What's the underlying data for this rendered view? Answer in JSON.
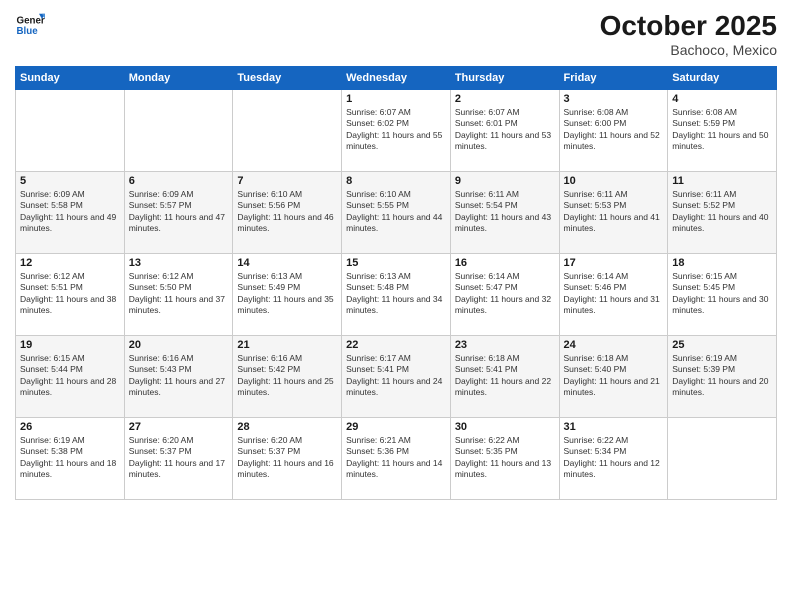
{
  "header": {
    "logo_general": "General",
    "logo_blue": "Blue",
    "month": "October 2025",
    "location": "Bachoco, Mexico"
  },
  "days_of_week": [
    "Sunday",
    "Monday",
    "Tuesday",
    "Wednesday",
    "Thursday",
    "Friday",
    "Saturday"
  ],
  "weeks": [
    [
      {
        "day": "",
        "sunrise": "",
        "sunset": "",
        "daylight": ""
      },
      {
        "day": "",
        "sunrise": "",
        "sunset": "",
        "daylight": ""
      },
      {
        "day": "",
        "sunrise": "",
        "sunset": "",
        "daylight": ""
      },
      {
        "day": "1",
        "sunrise": "Sunrise: 6:07 AM",
        "sunset": "Sunset: 6:02 PM",
        "daylight": "Daylight: 11 hours and 55 minutes."
      },
      {
        "day": "2",
        "sunrise": "Sunrise: 6:07 AM",
        "sunset": "Sunset: 6:01 PM",
        "daylight": "Daylight: 11 hours and 53 minutes."
      },
      {
        "day": "3",
        "sunrise": "Sunrise: 6:08 AM",
        "sunset": "Sunset: 6:00 PM",
        "daylight": "Daylight: 11 hours and 52 minutes."
      },
      {
        "day": "4",
        "sunrise": "Sunrise: 6:08 AM",
        "sunset": "Sunset: 5:59 PM",
        "daylight": "Daylight: 11 hours and 50 minutes."
      }
    ],
    [
      {
        "day": "5",
        "sunrise": "Sunrise: 6:09 AM",
        "sunset": "Sunset: 5:58 PM",
        "daylight": "Daylight: 11 hours and 49 minutes."
      },
      {
        "day": "6",
        "sunrise": "Sunrise: 6:09 AM",
        "sunset": "Sunset: 5:57 PM",
        "daylight": "Daylight: 11 hours and 47 minutes."
      },
      {
        "day": "7",
        "sunrise": "Sunrise: 6:10 AM",
        "sunset": "Sunset: 5:56 PM",
        "daylight": "Daylight: 11 hours and 46 minutes."
      },
      {
        "day": "8",
        "sunrise": "Sunrise: 6:10 AM",
        "sunset": "Sunset: 5:55 PM",
        "daylight": "Daylight: 11 hours and 44 minutes."
      },
      {
        "day": "9",
        "sunrise": "Sunrise: 6:11 AM",
        "sunset": "Sunset: 5:54 PM",
        "daylight": "Daylight: 11 hours and 43 minutes."
      },
      {
        "day": "10",
        "sunrise": "Sunrise: 6:11 AM",
        "sunset": "Sunset: 5:53 PM",
        "daylight": "Daylight: 11 hours and 41 minutes."
      },
      {
        "day": "11",
        "sunrise": "Sunrise: 6:11 AM",
        "sunset": "Sunset: 5:52 PM",
        "daylight": "Daylight: 11 hours and 40 minutes."
      }
    ],
    [
      {
        "day": "12",
        "sunrise": "Sunrise: 6:12 AM",
        "sunset": "Sunset: 5:51 PM",
        "daylight": "Daylight: 11 hours and 38 minutes."
      },
      {
        "day": "13",
        "sunrise": "Sunrise: 6:12 AM",
        "sunset": "Sunset: 5:50 PM",
        "daylight": "Daylight: 11 hours and 37 minutes."
      },
      {
        "day": "14",
        "sunrise": "Sunrise: 6:13 AM",
        "sunset": "Sunset: 5:49 PM",
        "daylight": "Daylight: 11 hours and 35 minutes."
      },
      {
        "day": "15",
        "sunrise": "Sunrise: 6:13 AM",
        "sunset": "Sunset: 5:48 PM",
        "daylight": "Daylight: 11 hours and 34 minutes."
      },
      {
        "day": "16",
        "sunrise": "Sunrise: 6:14 AM",
        "sunset": "Sunset: 5:47 PM",
        "daylight": "Daylight: 11 hours and 32 minutes."
      },
      {
        "day": "17",
        "sunrise": "Sunrise: 6:14 AM",
        "sunset": "Sunset: 5:46 PM",
        "daylight": "Daylight: 11 hours and 31 minutes."
      },
      {
        "day": "18",
        "sunrise": "Sunrise: 6:15 AM",
        "sunset": "Sunset: 5:45 PM",
        "daylight": "Daylight: 11 hours and 30 minutes."
      }
    ],
    [
      {
        "day": "19",
        "sunrise": "Sunrise: 6:15 AM",
        "sunset": "Sunset: 5:44 PM",
        "daylight": "Daylight: 11 hours and 28 minutes."
      },
      {
        "day": "20",
        "sunrise": "Sunrise: 6:16 AM",
        "sunset": "Sunset: 5:43 PM",
        "daylight": "Daylight: 11 hours and 27 minutes."
      },
      {
        "day": "21",
        "sunrise": "Sunrise: 6:16 AM",
        "sunset": "Sunset: 5:42 PM",
        "daylight": "Daylight: 11 hours and 25 minutes."
      },
      {
        "day": "22",
        "sunrise": "Sunrise: 6:17 AM",
        "sunset": "Sunset: 5:41 PM",
        "daylight": "Daylight: 11 hours and 24 minutes."
      },
      {
        "day": "23",
        "sunrise": "Sunrise: 6:18 AM",
        "sunset": "Sunset: 5:41 PM",
        "daylight": "Daylight: 11 hours and 22 minutes."
      },
      {
        "day": "24",
        "sunrise": "Sunrise: 6:18 AM",
        "sunset": "Sunset: 5:40 PM",
        "daylight": "Daylight: 11 hours and 21 minutes."
      },
      {
        "day": "25",
        "sunrise": "Sunrise: 6:19 AM",
        "sunset": "Sunset: 5:39 PM",
        "daylight": "Daylight: 11 hours and 20 minutes."
      }
    ],
    [
      {
        "day": "26",
        "sunrise": "Sunrise: 6:19 AM",
        "sunset": "Sunset: 5:38 PM",
        "daylight": "Daylight: 11 hours and 18 minutes."
      },
      {
        "day": "27",
        "sunrise": "Sunrise: 6:20 AM",
        "sunset": "Sunset: 5:37 PM",
        "daylight": "Daylight: 11 hours and 17 minutes."
      },
      {
        "day": "28",
        "sunrise": "Sunrise: 6:20 AM",
        "sunset": "Sunset: 5:37 PM",
        "daylight": "Daylight: 11 hours and 16 minutes."
      },
      {
        "day": "29",
        "sunrise": "Sunrise: 6:21 AM",
        "sunset": "Sunset: 5:36 PM",
        "daylight": "Daylight: 11 hours and 14 minutes."
      },
      {
        "day": "30",
        "sunrise": "Sunrise: 6:22 AM",
        "sunset": "Sunset: 5:35 PM",
        "daylight": "Daylight: 11 hours and 13 minutes."
      },
      {
        "day": "31",
        "sunrise": "Sunrise: 6:22 AM",
        "sunset": "Sunset: 5:34 PM",
        "daylight": "Daylight: 11 hours and 12 minutes."
      },
      {
        "day": "",
        "sunrise": "",
        "sunset": "",
        "daylight": ""
      }
    ]
  ]
}
